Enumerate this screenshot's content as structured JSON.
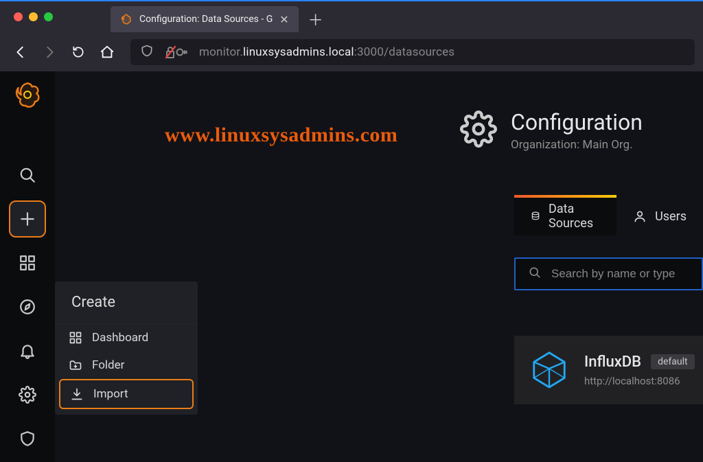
{
  "browser": {
    "tab_title": "Configuration: Data Sources - G",
    "url_prefix": "monitor.",
    "url_host": "linuxsysadmins.local",
    "url_port": ":3000",
    "url_path": "/datasources"
  },
  "watermark": "www.linuxsysadmins.com",
  "sidebar": {
    "flyout_header": "Create",
    "items": [
      {
        "label": "Dashboard"
      },
      {
        "label": "Folder"
      },
      {
        "label": "Import"
      }
    ]
  },
  "page": {
    "title": "Configuration",
    "subtitle": "Organization: Main Org."
  },
  "tabs": [
    {
      "label": "Data Sources"
    },
    {
      "label": "Users"
    }
  ],
  "search": {
    "placeholder": "Search by name or type"
  },
  "datasource": {
    "name": "InfluxDB",
    "badge": "default",
    "url": "http://localhost:8086"
  }
}
